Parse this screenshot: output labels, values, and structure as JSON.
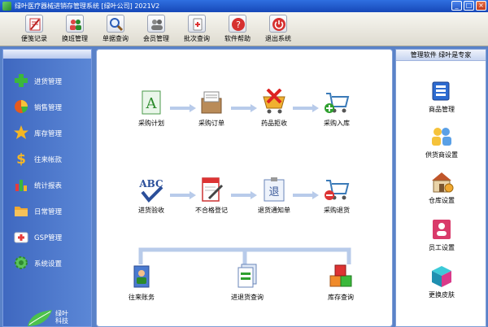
{
  "window": {
    "title": "绿叶医疗器械进销存管理系统 [绿叶公司] 2021V2",
    "controls": {
      "minimize": "_",
      "maximize": "□",
      "close": "×"
    }
  },
  "toolbar": {
    "items": [
      {
        "label": "便笺记录",
        "icon": "notepad-icon"
      },
      {
        "label": "换班管理",
        "icon": "users-icon"
      },
      {
        "label": "单据查询",
        "icon": "magnifier-icon"
      },
      {
        "label": "会员管理",
        "icon": "members-icon"
      },
      {
        "label": "批次查询",
        "icon": "batch-icon"
      },
      {
        "label": "软件帮助",
        "icon": "help-icon"
      },
      {
        "label": "退出系统",
        "icon": "power-icon"
      }
    ]
  },
  "sidebar": {
    "items": [
      {
        "label": "进货管理",
        "icon": "plus-icon"
      },
      {
        "label": "销售管理",
        "icon": "pie-icon"
      },
      {
        "label": "库存管理",
        "icon": "star-icon"
      },
      {
        "label": "往来帐款",
        "icon": "dollar-icon"
      },
      {
        "label": "统计报表",
        "icon": "bar-chart-icon"
      },
      {
        "label": "日常管理",
        "icon": "folder-icon"
      },
      {
        "label": "GSP管理",
        "icon": "medkit-icon"
      },
      {
        "label": "系统设置",
        "icon": "gear-icon"
      }
    ],
    "logo": {
      "line1": "绿叶",
      "line2": "科技"
    }
  },
  "flow": {
    "row1": [
      "采购计划",
      "采购订单",
      "药品拒收",
      "采购入库"
    ],
    "row2": [
      "进货验收",
      "不合格登记",
      "退货通知单",
      "采购退货"
    ],
    "row3": [
      "往来账务",
      "进退货查询",
      "库存查询"
    ]
  },
  "right_panel": {
    "header": "管理软件 绿叶是专家",
    "items": [
      {
        "label": "商品管理",
        "icon": "product-icon"
      },
      {
        "label": "供货商设置",
        "icon": "supplier-icon"
      },
      {
        "label": "仓库设置",
        "icon": "warehouse-icon"
      },
      {
        "label": "员工设置",
        "icon": "staff-icon"
      },
      {
        "label": "更换皮肤",
        "icon": "skin-icon"
      }
    ]
  },
  "colors": {
    "titlebar": "#1f58cc",
    "sidebar": "#4a74c8",
    "accent_green": "#2fa02f",
    "accent_red": "#d43030"
  }
}
